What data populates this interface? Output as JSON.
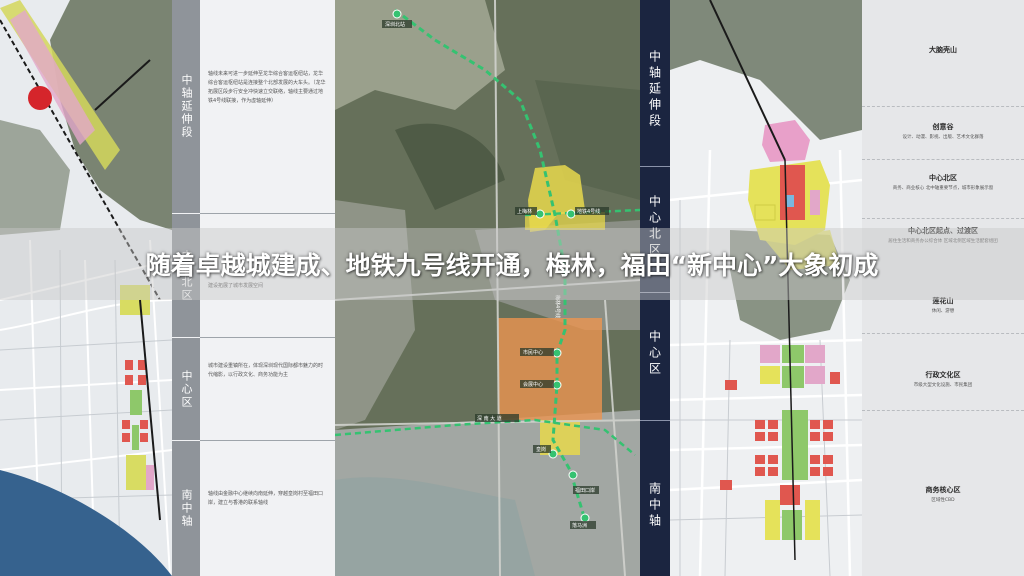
{
  "headline": "随着卓越城建成、地铁九号线开通，梅林，福田“新中心”大象初成",
  "left_legend": {
    "sections": [
      {
        "label": "中轴延伸段",
        "desc": "轴线未来可进一步延伸至龙华综合客运枢纽站，龙华综合客运枢纽站是连接整个北部发展的大车头。（龙华拓展区段步行安全冲快速立交联络，轴线主要通过地铁4号线联接，作为虚轴延伸）"
      },
      {
        "label": "中心北区",
        "desc": "建设拓展了城市发展空间"
      },
      {
        "label": "中心区",
        "desc": "城市建设重镇所在，体现深圳现代国际都市魅力的时代缩影，以行政文化、商务功能为主"
      },
      {
        "label": "南中轴",
        "desc": "轴线由金融中心继续向南延伸，穿越皇岗村至福田口岸，建立与香港的联系轴线"
      }
    ]
  },
  "mid_map": {
    "labels": {
      "station_1": "深圳北站",
      "station_2": "上梅林",
      "station_3": "梅林4号线",
      "station_4": "地铁4号线",
      "station_5": "市民中心",
      "station_6": "会展中心",
      "station_7": "皇岗",
      "station_8": "福田口岸",
      "station_9": "落马洲",
      "road": "深 南 大 道"
    }
  },
  "mid_legend": {
    "tabs": [
      "中轴延伸段",
      "中心北区",
      "中心区",
      "南中轴"
    ]
  },
  "right_legend": {
    "items": [
      {
        "title": "大脑壳山",
        "sub": ""
      },
      {
        "title": "创意谷",
        "sub": "设计、动漫、影视、出版、艺术文化群落"
      },
      {
        "title": "中心北区",
        "sub": "商务、商业核心 北中轴重要节点，城市形象展示窗"
      },
      {
        "title": "中心北区起点、过渡区",
        "sub": "居住生活和商务办公综合体 区域北侧区域生活配套组团"
      },
      {
        "title": "莲花山",
        "sub": "休闲、游憩"
      },
      {
        "title": "行政文化区",
        "sub": "市级大型文化设施、市民集团"
      },
      {
        "title": "商务核心区",
        "sub": "区域性CBD"
      }
    ]
  },
  "colors": {
    "navy": "#1b2540",
    "commercial": "#e8e35a",
    "residential": "#f0b6cf",
    "public": "#e0574f",
    "green": "#8ec86a",
    "metro": "#35c271",
    "orange_zone": "#ec9550"
  }
}
